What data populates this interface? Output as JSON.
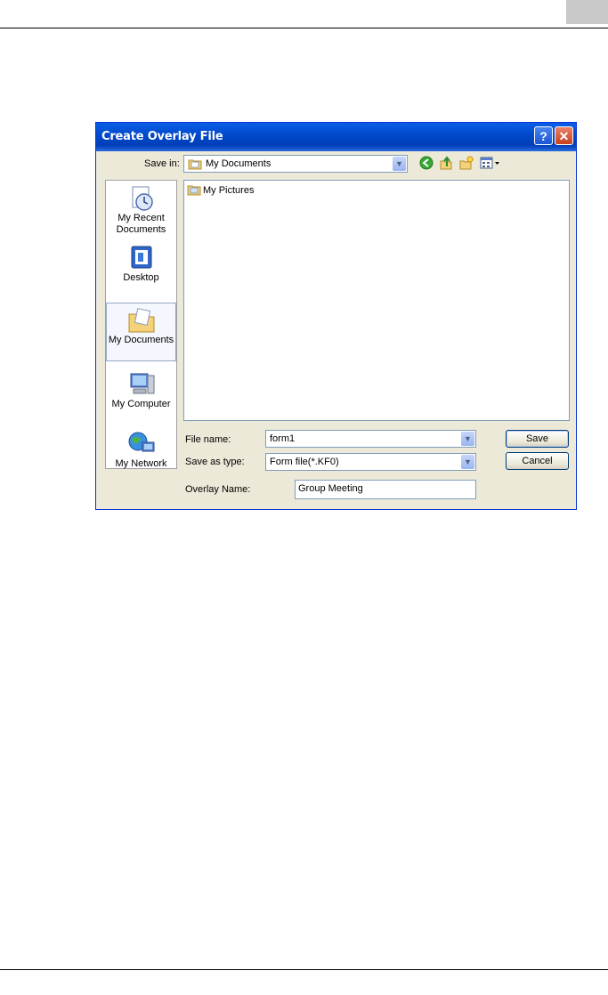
{
  "dialog": {
    "title": "Create Overlay File",
    "help_glyph": "?",
    "close_glyph": "✕"
  },
  "save_in": {
    "label": "Save in:",
    "value": "My Documents"
  },
  "places": [
    {
      "label_line1": "My Recent",
      "label_line2": "Documents",
      "icon": "recent-documents-icon"
    },
    {
      "label_line1": "Desktop",
      "label_line2": "",
      "icon": "desktop-icon"
    },
    {
      "label_line1": "My Documents",
      "label_line2": "",
      "icon": "my-documents-icon",
      "selected": true
    },
    {
      "label_line1": "My Computer",
      "label_line2": "",
      "icon": "my-computer-icon"
    },
    {
      "label_line1": "My Network",
      "label_line2": "",
      "icon": "my-network-icon"
    }
  ],
  "files": [
    {
      "name": "My Pictures",
      "icon": "folder-icon"
    }
  ],
  "file_name": {
    "label": "File name:",
    "value": "form1"
  },
  "save_as_type": {
    "label": "Save as type:",
    "value": "Form file(*.KF0)"
  },
  "overlay_name": {
    "label": "Overlay Name:",
    "value": "Group Meeting"
  },
  "buttons": {
    "save": "Save",
    "cancel": "Cancel"
  },
  "colors": {
    "titlebar": "#0148c9",
    "dialog_bg": "#ece9d8"
  }
}
